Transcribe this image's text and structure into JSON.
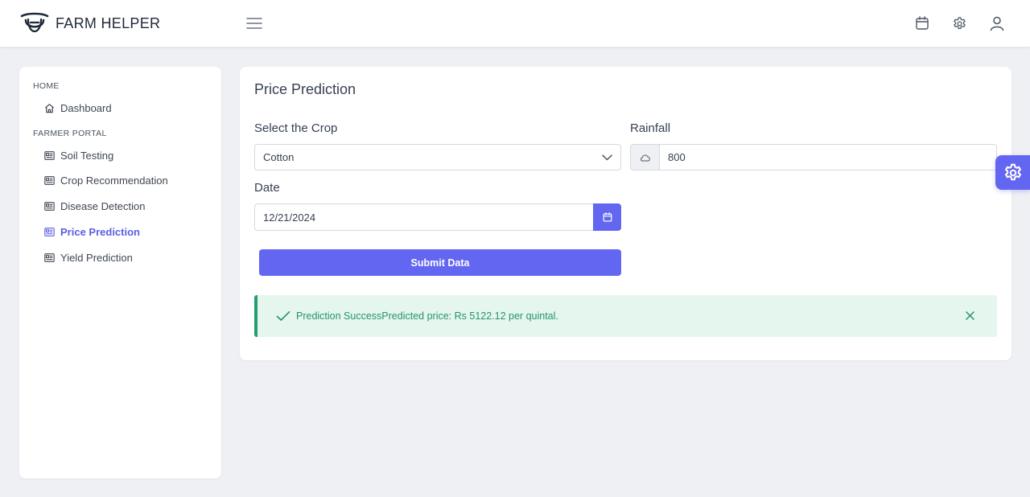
{
  "brand": {
    "name": "FARM HELPER"
  },
  "header": {
    "icons": [
      "menu-icon",
      "calendar-icon",
      "settings-icon",
      "user-icon"
    ]
  },
  "sidebar": {
    "sections": [
      {
        "label": "HOME",
        "items": [
          {
            "label": "Dashboard",
            "icon": "home-icon"
          }
        ]
      },
      {
        "label": "FARMER PORTAL",
        "items": [
          {
            "label": "Soil Testing",
            "icon": "id-card-icon"
          },
          {
            "label": "Crop Recommendation",
            "icon": "id-card-icon"
          },
          {
            "label": "Disease Detection",
            "icon": "id-card-icon"
          },
          {
            "label": "Price Prediction",
            "icon": "id-card-icon",
            "active": true
          },
          {
            "label": "Yield Prediction",
            "icon": "id-card-icon"
          }
        ]
      }
    ]
  },
  "main": {
    "title": "Price Prediction",
    "crop": {
      "label": "Select the Crop",
      "value": "Cotton"
    },
    "rainfall": {
      "label": "Rainfall",
      "value": "800"
    },
    "date": {
      "label": "Date",
      "value": "12/21/2024"
    },
    "submit_label": "Submit Data",
    "alert": {
      "text": "Prediction SuccessPredicted price: Rs 5122.12 per quintal."
    }
  },
  "colors": {
    "accent": "#6366f1",
    "success": "#22a06b",
    "success_bg": "#e5f6ee"
  }
}
